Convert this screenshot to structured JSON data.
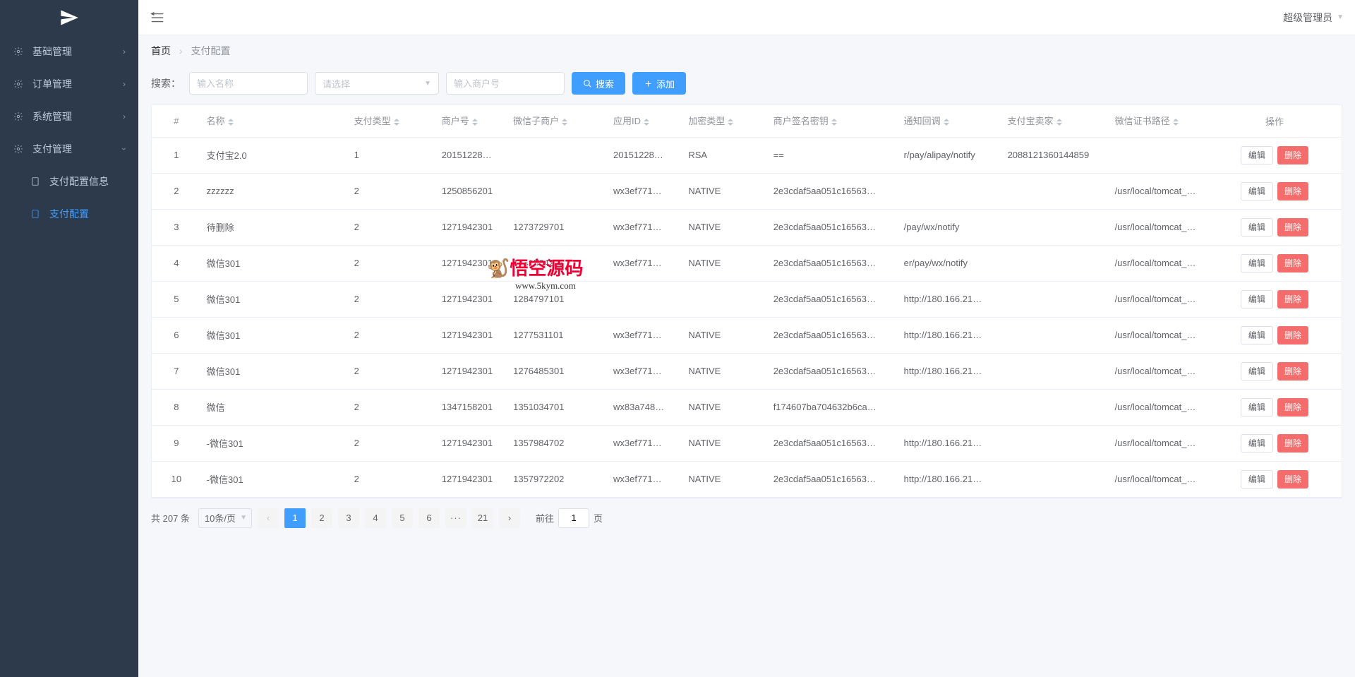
{
  "header": {
    "user_label": "超级管理员"
  },
  "sidebar": {
    "items": [
      {
        "label": "基础管理",
        "icon": "gear"
      },
      {
        "label": "订单管理",
        "icon": "gear"
      },
      {
        "label": "系统管理",
        "icon": "gear"
      },
      {
        "label": "支付管理",
        "icon": "gear"
      }
    ],
    "submenu_pay": [
      {
        "label": "支付配置信息",
        "active": false
      },
      {
        "label": "支付配置",
        "active": true
      }
    ]
  },
  "breadcrumb": {
    "home": "首页",
    "current": "支付配置"
  },
  "search": {
    "label": "搜索：",
    "name_placeholder": "输入名称",
    "select_placeholder": "请选择",
    "mch_placeholder": "输入商户号",
    "btn_search": "搜索",
    "btn_add": "添加"
  },
  "table": {
    "columns": [
      "#",
      "名称",
      "支付类型",
      "商户号",
      "微信子商户",
      "应用ID",
      "加密类型",
      "商户签名密钥",
      "通知回调",
      "支付宝卖家",
      "微信证书路径",
      "操作"
    ],
    "edit_label": "编辑",
    "delete_label": "删除",
    "rows": [
      {
        "idx": "1",
        "name": "支付宝2.0",
        "type": "1",
        "mch": "20151228…",
        "sub": "",
        "app": "20151228…",
        "enc": "RSA",
        "sign": "==",
        "notify": "r/pay/alipay/notify",
        "seller": "2088121360144859",
        "cert": ""
      },
      {
        "idx": "2",
        "name": "zzzzzz",
        "type": "2",
        "mch": "1250856201",
        "sub": "",
        "app": "wx3ef771…",
        "enc": "NATIVE",
        "sign": "2e3cdaf5aa051c16563…",
        "notify": "",
        "seller": "",
        "cert": "/usr/local/tomcat_…"
      },
      {
        "idx": "3",
        "name": "待删除",
        "type": "2",
        "mch": "1271942301",
        "sub": "1273729701",
        "app": "wx3ef771…",
        "enc": "NATIVE",
        "sign": "2e3cdaf5aa051c16563…",
        "notify": "/pay/wx/notify",
        "seller": "",
        "cert": "/usr/local/tomcat_…"
      },
      {
        "idx": "4",
        "name": "微信301",
        "type": "2",
        "mch": "1271942301",
        "sub": "1341564201",
        "app": "wx3ef771…",
        "enc": "NATIVE",
        "sign": "2e3cdaf5aa051c16563…",
        "notify": "er/pay/wx/notify",
        "seller": "",
        "cert": "/usr/local/tomcat_…"
      },
      {
        "idx": "5",
        "name": "微信301",
        "type": "2",
        "mch": "1271942301",
        "sub": "1284797101",
        "app": "",
        "enc": "",
        "sign": "2e3cdaf5aa051c16563…",
        "notify": "http://180.166.21…",
        "seller": "",
        "cert": "/usr/local/tomcat_…"
      },
      {
        "idx": "6",
        "name": "微信301",
        "type": "2",
        "mch": "1271942301",
        "sub": "1277531101",
        "app": "wx3ef771…",
        "enc": "NATIVE",
        "sign": "2e3cdaf5aa051c16563…",
        "notify": "http://180.166.21…",
        "seller": "",
        "cert": "/usr/local/tomcat_…"
      },
      {
        "idx": "7",
        "name": "微信301",
        "type": "2",
        "mch": "1271942301",
        "sub": "1276485301",
        "app": "wx3ef771…",
        "enc": "NATIVE",
        "sign": "2e3cdaf5aa051c16563…",
        "notify": "http://180.166.21…",
        "seller": "",
        "cert": "/usr/local/tomcat_…"
      },
      {
        "idx": "8",
        "name": "微信",
        "type": "2",
        "mch": "1347158201",
        "sub": "1351034701",
        "app": "wx83a748…",
        "enc": "NATIVE",
        "sign": "f174607ba704632b6ca…",
        "notify": "",
        "seller": "",
        "cert": "/usr/local/tomcat_…"
      },
      {
        "idx": "9",
        "name": "-微信301",
        "type": "2",
        "mch": "1271942301",
        "sub": "1357984702",
        "app": "wx3ef771…",
        "enc": "NATIVE",
        "sign": "2e3cdaf5aa051c16563…",
        "notify": "http://180.166.21…",
        "seller": "",
        "cert": "/usr/local/tomcat_…"
      },
      {
        "idx": "10",
        "name": "-微信301",
        "type": "2",
        "mch": "1271942301",
        "sub": "1357972202",
        "app": "wx3ef771…",
        "enc": "NATIVE",
        "sign": "2e3cdaf5aa051c16563…",
        "notify": "http://180.166.21…",
        "seller": "",
        "cert": "/usr/local/tomcat_…"
      }
    ]
  },
  "pagination": {
    "total_text": "共 207 条",
    "page_size": "10条/页",
    "pages": [
      "1",
      "2",
      "3",
      "4",
      "5",
      "6"
    ],
    "last_page": "21",
    "current_page": "1",
    "jump_prefix": "前往",
    "jump_suffix": "页",
    "jump_value": "1"
  },
  "watermark": {
    "title": "悟空源码",
    "url": "www.5kym.com"
  }
}
